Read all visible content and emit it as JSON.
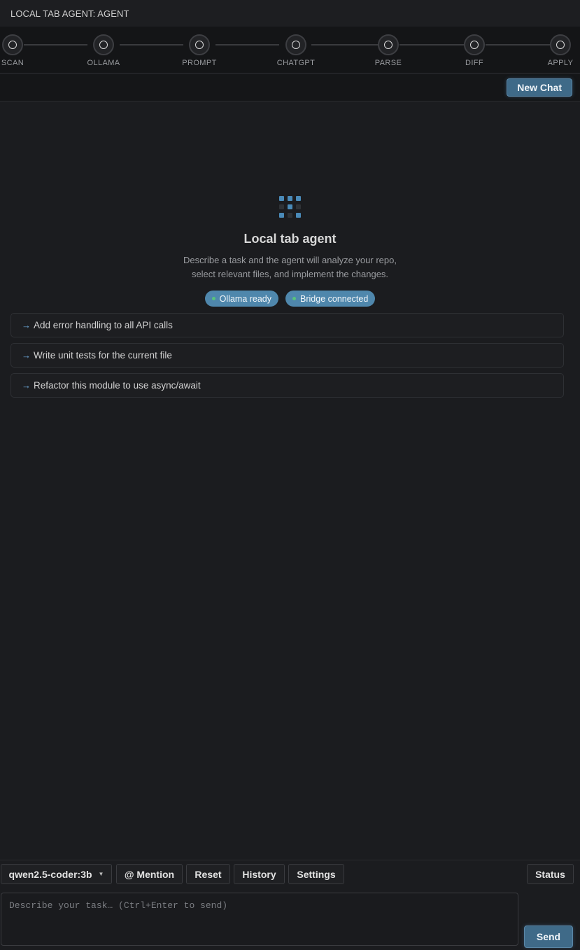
{
  "header": {
    "title": "LOCAL TAB AGENT: AGENT"
  },
  "pipeline": {
    "steps": [
      {
        "label": "SCAN"
      },
      {
        "label": "OLLAMA"
      },
      {
        "label": "PROMPT"
      },
      {
        "label": "CHATGPT"
      },
      {
        "label": "PARSE"
      },
      {
        "label": "DIFF"
      },
      {
        "label": "APPLY"
      }
    ]
  },
  "toolbar": {
    "new_chat_label": "New Chat"
  },
  "empty_state": {
    "title": "Local tab agent",
    "description_line1": "Describe a task and the agent will analyze your repo,",
    "description_line2": "select relevant files, and implement the changes.",
    "badges": [
      {
        "label": "Ollama ready"
      },
      {
        "label": "Bridge connected"
      }
    ]
  },
  "suggestions": [
    {
      "arrow": "→",
      "label": "Add error handling to all API calls"
    },
    {
      "arrow": "→",
      "label": "Write unit tests for the current file"
    },
    {
      "arrow": "→",
      "label": "Refactor this module to use async/await"
    }
  ],
  "controls": {
    "model_select": "qwen2.5-coder:3b",
    "mention_label": "@ Mention",
    "reset_label": "Reset",
    "history_label": "History",
    "settings_label": "Settings",
    "status_label": "Status"
  },
  "input": {
    "placeholder": "Describe your task… (Ctrl+Enter to send)",
    "value": ""
  },
  "send_label": "Send",
  "colors": {
    "accent": "#3f6a88",
    "badge": "#4f87ac",
    "status_dot": "#58c27d",
    "background": "#1b1c1f"
  }
}
